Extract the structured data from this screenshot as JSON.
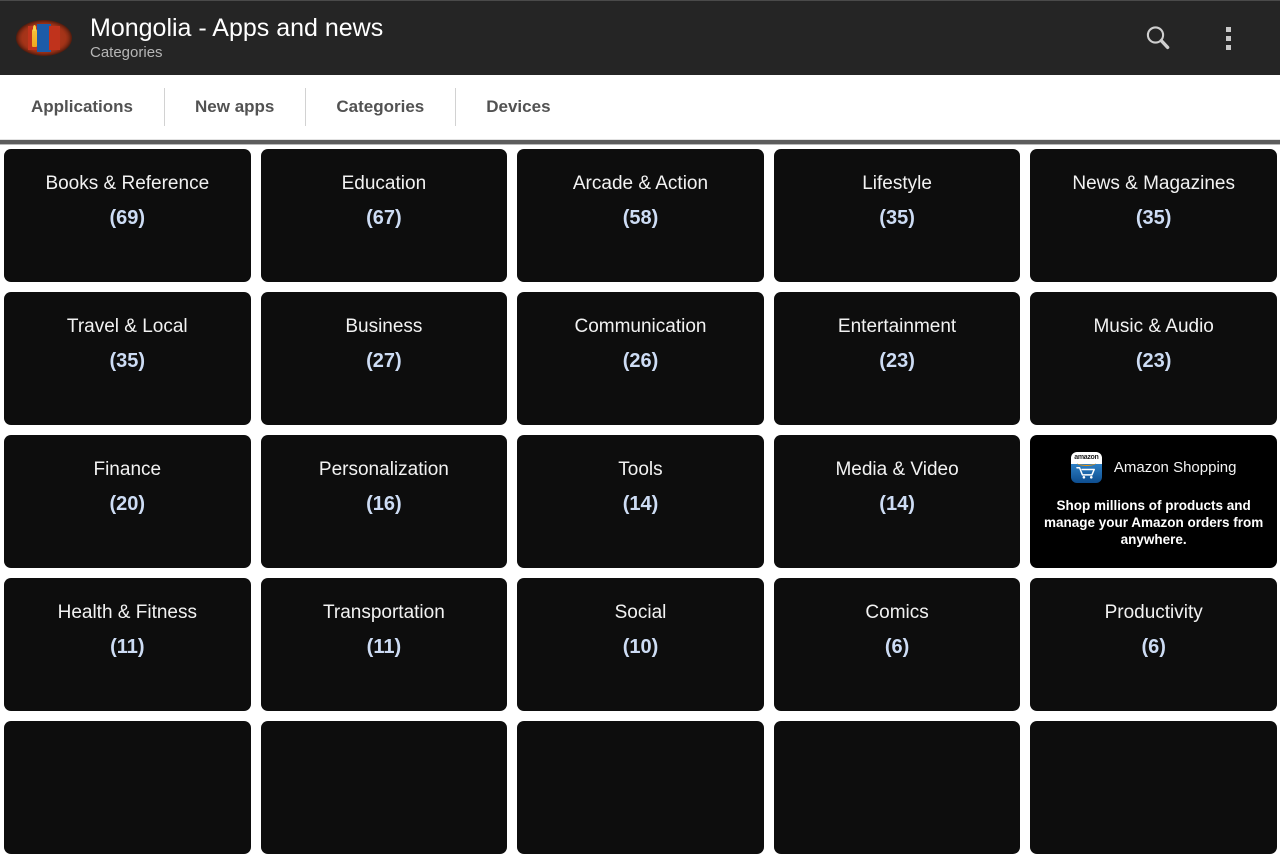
{
  "appbar": {
    "logo_icon": "mongolia-flag-oval-icon",
    "title": "Mongolia - Apps and news",
    "subtitle": "Categories",
    "search_icon": "search-icon",
    "overflow_icon": "overflow-menu-icon"
  },
  "tabs": [
    {
      "label": "Applications",
      "active": false
    },
    {
      "label": "New apps",
      "active": false
    },
    {
      "label": "Categories",
      "active": true
    },
    {
      "label": "Devices",
      "active": false
    }
  ],
  "colors": {
    "appbar_background": "#252525",
    "page_background": "#ffffff",
    "tile_background": "#0d0d0d",
    "tile_name_text": "#f2f2f2",
    "tile_count_text": "#cddcf4",
    "tab_text": "#525252",
    "divider": "#5c5c5c"
  },
  "grid": {
    "rows": [
      [
        {
          "type": "category",
          "name": "Books & Reference",
          "count": "(69)"
        },
        {
          "type": "category",
          "name": "Education",
          "count": "(67)"
        },
        {
          "type": "category",
          "name": "Arcade & Action",
          "count": "(58)"
        },
        {
          "type": "category",
          "name": "Lifestyle",
          "count": "(35)"
        },
        {
          "type": "category",
          "name": "News & Magazines",
          "count": "(35)"
        }
      ],
      [
        {
          "type": "category",
          "name": "Travel & Local",
          "count": "(35)"
        },
        {
          "type": "category",
          "name": "Business",
          "count": "(27)"
        },
        {
          "type": "category",
          "name": "Communication",
          "count": "(26)"
        },
        {
          "type": "category",
          "name": "Entertainment",
          "count": "(23)"
        },
        {
          "type": "category",
          "name": "Music & Audio",
          "count": "(23)"
        }
      ],
      [
        {
          "type": "category",
          "name": "Finance",
          "count": "(20)"
        },
        {
          "type": "category",
          "name": "Personalization",
          "count": "(16)"
        },
        {
          "type": "category",
          "name": "Tools",
          "count": "(14)"
        },
        {
          "type": "category",
          "name": "Media & Video",
          "count": "(14)"
        },
        {
          "type": "ad",
          "icon": "amazon-shopping-app-icon",
          "icon_word": "amazon",
          "title": "Amazon Shopping",
          "body": "Shop millions of products and manage your Amazon orders from anywhere."
        }
      ],
      [
        {
          "type": "category",
          "name": "Health & Fitness",
          "count": "(11)"
        },
        {
          "type": "category",
          "name": "Transportation",
          "count": "(11)"
        },
        {
          "type": "category",
          "name": "Social",
          "count": "(10)"
        },
        {
          "type": "category",
          "name": "Comics",
          "count": "(6)"
        },
        {
          "type": "category",
          "name": "Productivity",
          "count": "(6)"
        }
      ],
      [
        {
          "type": "category",
          "name": "",
          "count": ""
        },
        {
          "type": "category",
          "name": "",
          "count": ""
        },
        {
          "type": "category",
          "name": "",
          "count": ""
        },
        {
          "type": "category",
          "name": "",
          "count": ""
        },
        {
          "type": "category",
          "name": "",
          "count": ""
        }
      ]
    ]
  }
}
